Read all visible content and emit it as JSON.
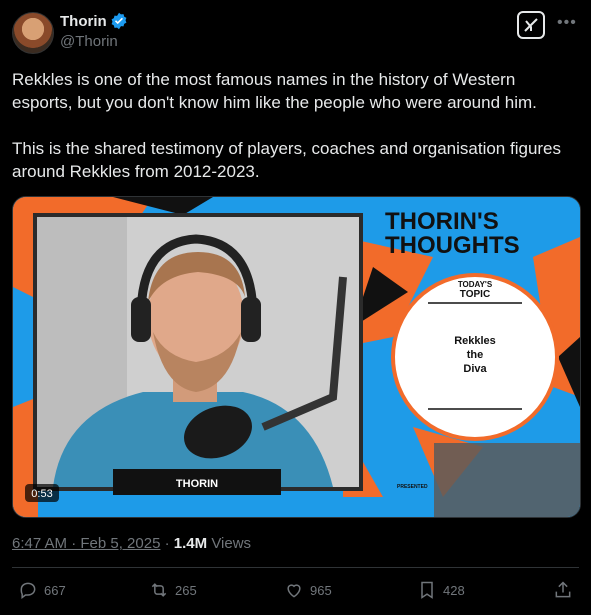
{
  "author": {
    "name": "Thorin",
    "handle": "@Thorin"
  },
  "tweet": {
    "text": "Rekkles is one of the most famous names in the history of Western esports, but you don't know him like the people who were around him.\n\nThis is the shared testimony of players, coaches and organisation figures around Rekkles from 2012-2023."
  },
  "video": {
    "duration": "0:53",
    "nameplate": "THORIN",
    "brand_line1": "THORIN'S",
    "brand_line2": "THOUGHTS",
    "todays": "TODAY'S",
    "topic": "TOPIC",
    "topic_text_1": "Rekkles",
    "topic_text_2": "the",
    "topic_text_3": "Diva",
    "presented": "PRESENTED"
  },
  "meta": {
    "time": "6:47 AM · Feb 5, 2025",
    "separator": " · ",
    "views_count": "1.4M",
    "views_label": "Views"
  },
  "actions": {
    "replies": "667",
    "reposts": "265",
    "likes": "965",
    "bookmarks": "428"
  },
  "colors": {
    "accent": "#1d9bf0",
    "background": "#000000",
    "muted": "#71767b",
    "orange": "#f26b2a"
  }
}
